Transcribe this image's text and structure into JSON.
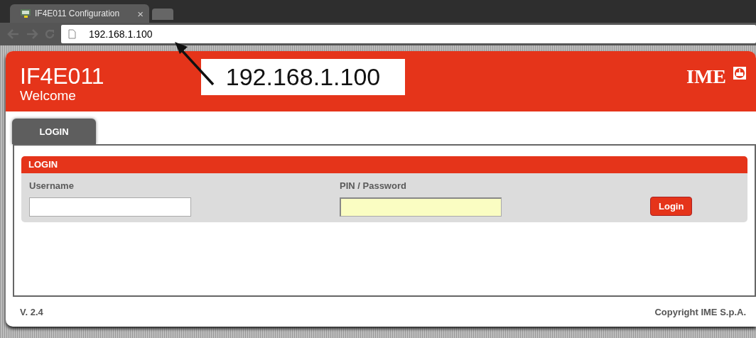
{
  "browser": {
    "tabs": [
      {
        "kind": "page",
        "title": "IF4E011 Configuration",
        "close": "×",
        "selected": true
      },
      {
        "kind": "new",
        "selected": false
      }
    ],
    "address": "192.168.1.100"
  },
  "callout": {
    "text": "192.168.1.100"
  },
  "header": {
    "title": "IF4E011",
    "subtitle": "Welcome",
    "logo": "IME"
  },
  "tabs": [
    {
      "label": "LOGIN",
      "selected": true
    }
  ],
  "login_panel": {
    "title": "LOGIN",
    "fields": [
      {
        "label": "Username",
        "kind": "text"
      },
      {
        "label": "PIN / Password",
        "kind": "password"
      }
    ],
    "button": "Login"
  },
  "footer": {
    "version": "V. 2.4",
    "copyright": "Copyright IME S.p.A."
  }
}
